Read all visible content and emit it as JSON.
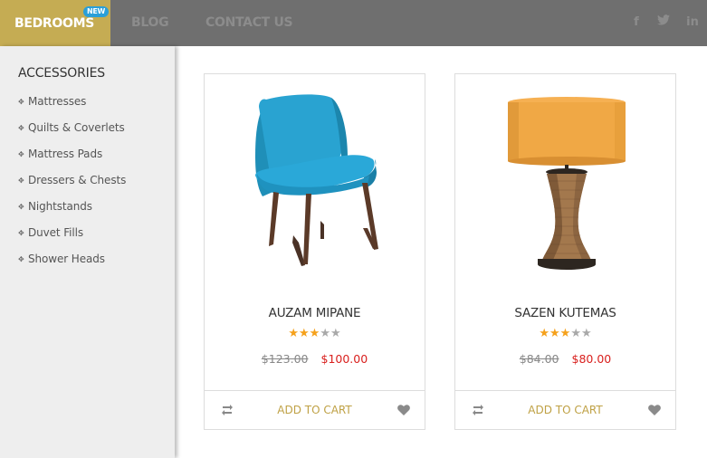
{
  "nav": {
    "active": "BEDROOMS",
    "badge": "NEW",
    "links": [
      "BLOG",
      "CONTACT US"
    ],
    "social": [
      "f",
      "twitter-icon",
      "in"
    ]
  },
  "sidebar": {
    "title": "ACCESSORIES",
    "items": [
      "Mattresses",
      "Quilts & Coverlets",
      "Mattress Pads",
      "Dressers & Chests",
      "Nightstands",
      "Duvet Fills",
      "Shower Heads"
    ]
  },
  "products": [
    {
      "name": "AUZAM MIPANE",
      "rating": 3,
      "max_rating": 5,
      "old_price": "$123.00",
      "price": "$100.00",
      "cart_label": "ADD TO CART",
      "image": "blue-armchair"
    },
    {
      "name": "SAZEN KUTEMAS",
      "rating": 3,
      "max_rating": 5,
      "old_price": "$84.00",
      "price": "$80.00",
      "cart_label": "ADD TO CART",
      "image": "orange-table-lamp"
    }
  ],
  "colors": {
    "accent": "#c5ac53",
    "topbar": "#6f6f6f",
    "price": "#d9201e",
    "star": "#f5a11b"
  }
}
